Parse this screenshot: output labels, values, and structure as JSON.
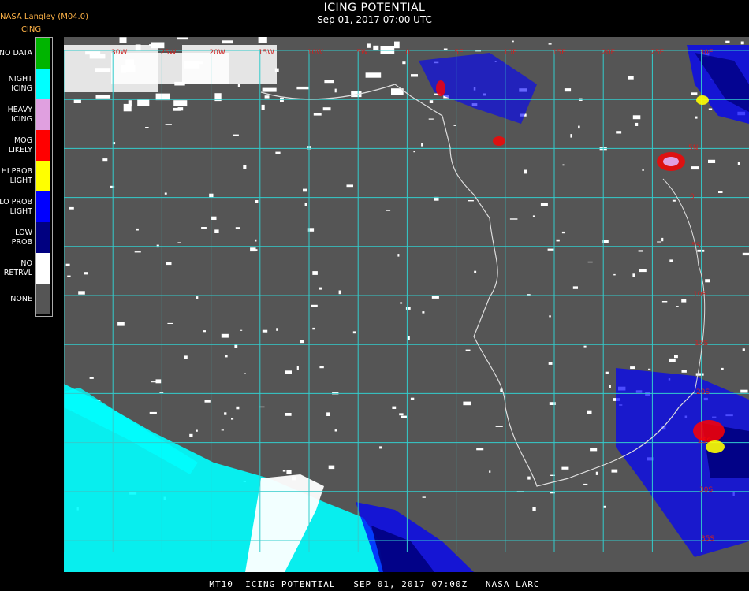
{
  "header": {
    "source": "NASA Langley (M04.0)",
    "product": "ICING",
    "title": "ICING POTENTIAL",
    "subtitle": "Sep 01, 2017 07:00 UTC"
  },
  "legend": [
    {
      "label": "NO DATA",
      "color": "#00b400"
    },
    {
      "label": "NIGHT\nICING",
      "color": "#00ffff"
    },
    {
      "label": "HEAVY\nICING",
      "color": "#e0a0e0"
    },
    {
      "label": "MOG\nLIKELY",
      "color": "#ff0000"
    },
    {
      "label": "HI PROB\nLIGHT",
      "color": "#ffff00"
    },
    {
      "label": "LO PROB\nLIGHT",
      "color": "#0000ff"
    },
    {
      "label": "LOW\nPROB",
      "color": "#000080"
    },
    {
      "label": "NO\nRETRVL",
      "color": "#ffffff"
    },
    {
      "label": "NONE",
      "color": "#555555"
    }
  ],
  "map": {
    "background": "#555555",
    "grid_color": "#33cccc",
    "coast_color": "#dddddd",
    "lon_labels": [
      "30W",
      "25W",
      "20W",
      "15W",
      "10W",
      "5W",
      "0",
      "5E",
      "10E",
      "15E",
      "20E",
      "25E",
      "30E",
      "35E"
    ],
    "lat_labels": [
      "5N",
      "0",
      "5S",
      "10S",
      "15S",
      "20S",
      "25S",
      "30S",
      "35S"
    ]
  },
  "footer": "MT10  ICING POTENTIAL   SEP 01, 2017 07:00Z   NASA LARC"
}
